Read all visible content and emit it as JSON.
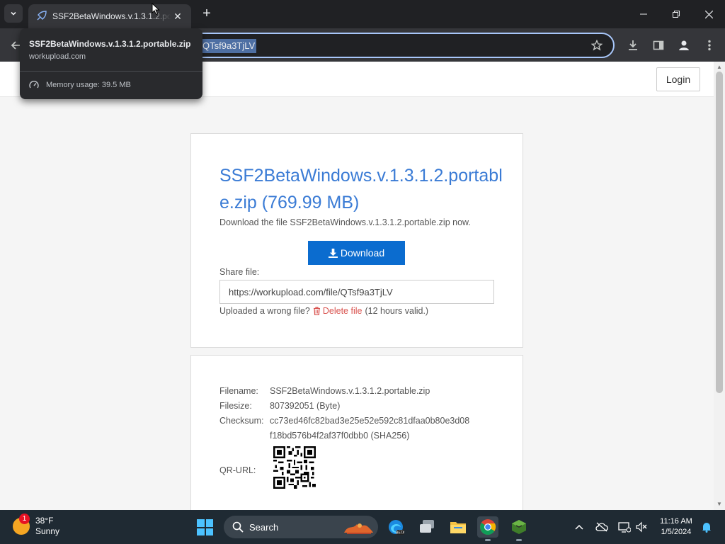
{
  "browser": {
    "tab_title": "SSF2BetaWindows.v.1.3.1.2.portable.zip",
    "url_selected": "QTsf9a3TjLV",
    "hover_card": {
      "title": "SSF2BetaWindows.v.1.3.1.2.portable.zip",
      "domain": "workupload.com",
      "memory": "Memory usage: 39.5 MB"
    }
  },
  "header": {
    "login_label": "Login"
  },
  "file": {
    "title": "SSF2BetaWindows.v.1.3.1.2.portable.zip (769.99 MB)",
    "subtitle": "Download the file SSF2BetaWindows.v.1.3.1.2.portable.zip now.",
    "download_label": "Download",
    "share_label": "Share file:",
    "share_url": "https://workupload.com/file/QTsf9a3TjLV",
    "wrong_file_text": "Uploaded a wrong file?",
    "delete_label": "Delete file",
    "valid_text": "(12 hours valid.)"
  },
  "details": {
    "filename_label": "Filename:",
    "filename": "SSF2BetaWindows.v.1.3.1.2.portable.zip",
    "filesize_label": "Filesize:",
    "filesize": "807392051 (Byte)",
    "checksum_label": "Checksum:",
    "checksum_line1": "cc73ed46fc82bad3e25e52e592c81dfaa0b80e3d08",
    "checksum_line2": "f18bd576b4f2af37f0dbb0 (SHA256)",
    "qr_label": "QR-URL:"
  },
  "taskbar": {
    "weather_temp": "38°F",
    "weather_desc": "Sunny",
    "weather_badge": "1",
    "search_label": "Search",
    "time": "11:16 AM",
    "date": "1/5/2024"
  },
  "colors": {
    "link_blue": "#3a7bd5",
    "download_button": "#0b6ccf",
    "delete_red": "#d9534f",
    "taskbar": "#1f2a33"
  }
}
